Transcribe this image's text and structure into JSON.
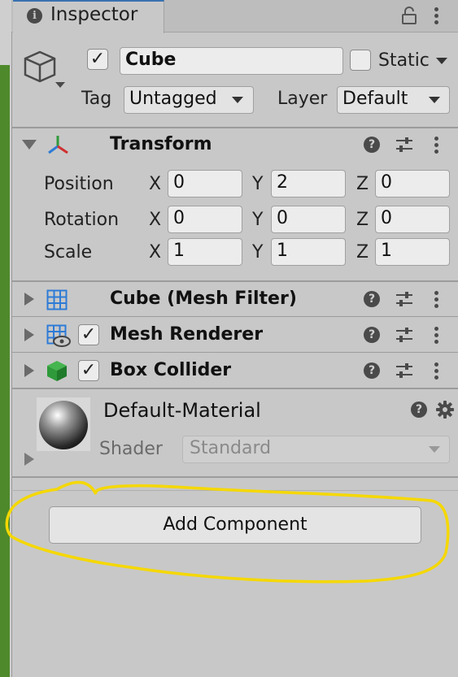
{
  "tab": {
    "title": "Inspector"
  },
  "object": {
    "active": true,
    "name": "Cube",
    "static_label": "Static",
    "tag_label": "Tag",
    "tag_value": "Untagged",
    "layer_label": "Layer",
    "layer_value": "Default"
  },
  "transform": {
    "title": "Transform",
    "rows": [
      {
        "label": "Position",
        "x": "0",
        "y": "2",
        "z": "0"
      },
      {
        "label": "Rotation",
        "x": "0",
        "y": "0",
        "z": "0"
      },
      {
        "label": "Scale",
        "x": "1",
        "y": "1",
        "z": "1"
      }
    ],
    "axis": {
      "x": "X",
      "y": "Y",
      "z": "Z"
    }
  },
  "components": [
    {
      "title": "Cube (Mesh Filter)",
      "has_checkbox": false
    },
    {
      "title": "Mesh Renderer",
      "has_checkbox": true,
      "checked": true
    },
    {
      "title": "Box Collider",
      "has_checkbox": true,
      "checked": true
    }
  ],
  "material": {
    "name": "Default-Material",
    "shader_label": "Shader",
    "shader_value": "Standard"
  },
  "add_component_label": "Add Component",
  "colors": {
    "highlight": "#f5d800",
    "grid_icon": "#2e7bd6",
    "collider_icon": "#2f9a3a"
  },
  "icons": {
    "info": "info-icon",
    "lock": "lock-icon",
    "cube": "cube-icon",
    "transform": "transform-axes-icon",
    "help": "help-icon",
    "presets": "sliders-icon",
    "menu": "kebab-icon",
    "settings": "gear-icon"
  }
}
